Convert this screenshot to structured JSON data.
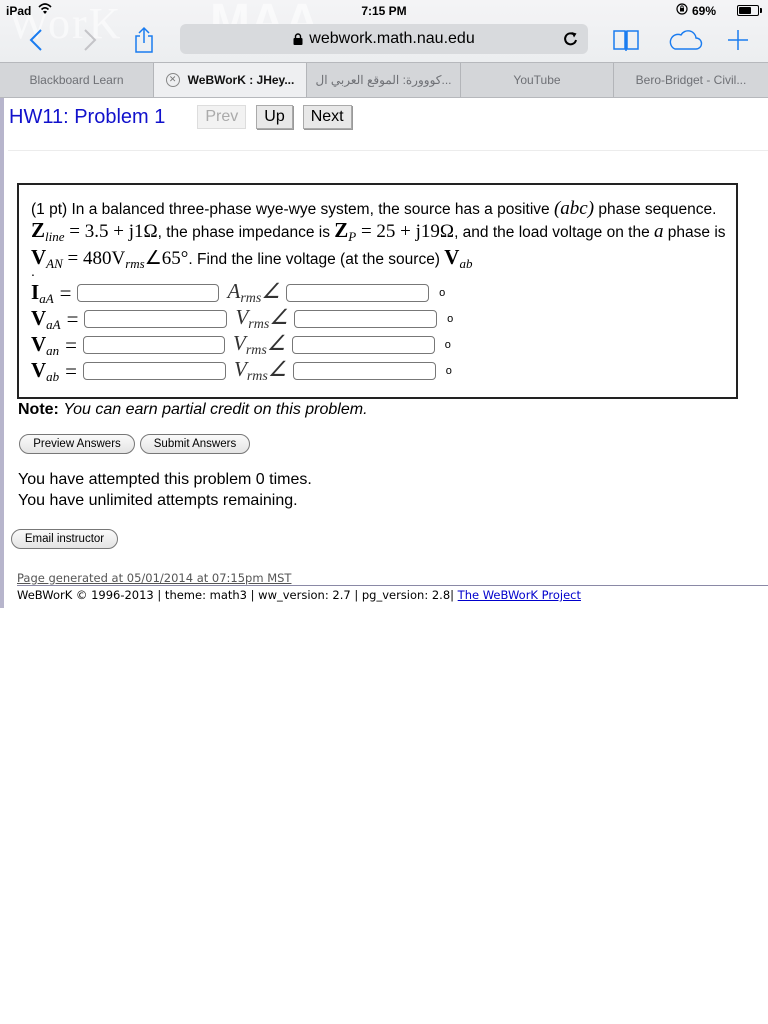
{
  "status_bar": {
    "carrier": "iPad",
    "time": "7:15 PM",
    "battery_percent_label": "69%",
    "battery_level": 0.69
  },
  "browser": {
    "url": "webwork.math.nau.edu",
    "tabs": [
      {
        "label": "Blackboard Learn",
        "active": false
      },
      {
        "label": "WeBWorK : JHey...",
        "active": true
      },
      {
        "label": "...كووورة: الموقع العربي ال",
        "active": false
      },
      {
        "label": "YouTube",
        "active": false
      },
      {
        "label": "Bero-Bridget - Civil...",
        "active": false
      }
    ],
    "icons": {
      "back": "chevron-left-icon",
      "forward": "chevron-right-icon",
      "share": "share-icon",
      "lock": "lock-icon",
      "reload": "reload-icon",
      "bookmarks": "book-icon",
      "icloud": "cloud-icon",
      "new_tab": "plus-icon"
    }
  },
  "header": {
    "title": "HW11: Problem 1",
    "prev_label": "Prev",
    "up_label": "Up",
    "next_label": "Next"
  },
  "problem": {
    "points": "(1 pt)",
    "text_1": " In a balanced three-phase wye-wye system, the source has a positive ",
    "seq": "(abc)",
    "text_2": " phase sequence. ",
    "zline_sym": "Z",
    "zline_sub": "line",
    "zline_val": " = 3.5 + j1Ω",
    "text_3": ", the phase impedance is ",
    "zp_sym": "Z",
    "zp_sub": "P",
    "zp_val": " = 25 + j19Ω",
    "text_4": ", and the load voltage on the ",
    "phase": "a",
    "text_5": " phase is ",
    "van_sym": "V",
    "van_sub": "AN",
    "van_val": " = 480V",
    "van_rms": "rms",
    "van_angle": "∠65°",
    "text_6": ". Find the line voltage (at the source) ",
    "vab_sym": "V",
    "vab_sub": "ab",
    "trailing": ".",
    "answers": [
      {
        "symbol": "I",
        "sub": "aA",
        "unit": "A",
        "unit_sub": "rms",
        "magnitude": "",
        "angle": "",
        "degree": "o"
      },
      {
        "symbol": "V",
        "sub": "aA",
        "unit": "V",
        "unit_sub": "rms",
        "magnitude": "",
        "angle": "",
        "degree": "o"
      },
      {
        "symbol": "V",
        "sub": "an",
        "unit": "V",
        "unit_sub": "rms",
        "magnitude": "",
        "angle": "",
        "degree": "o"
      },
      {
        "symbol": "V",
        "sub": "ab",
        "unit": "V",
        "unit_sub": "rms",
        "magnitude": "",
        "angle": "",
        "degree": "o"
      }
    ],
    "equals": "=",
    "angle_symbol": "∠"
  },
  "note": {
    "label": "Note:",
    "text": "You can earn partial credit on this problem."
  },
  "buttons": {
    "preview": "Preview Answers",
    "submit": "Submit Answers",
    "email": "Email instructor"
  },
  "attempts": {
    "line1": "You have attempted this problem 0 times.",
    "line2": "You have unlimited attempts remaining."
  },
  "footer": {
    "generated": "Page generated at 05/01/2014 at 07:15pm MST",
    "copyright": "WeBWorK © 1996-2013 | theme: math3 | ww_version: 2.7 | pg_version: 2.8| ",
    "project_link": "The WeBWorK Project"
  }
}
